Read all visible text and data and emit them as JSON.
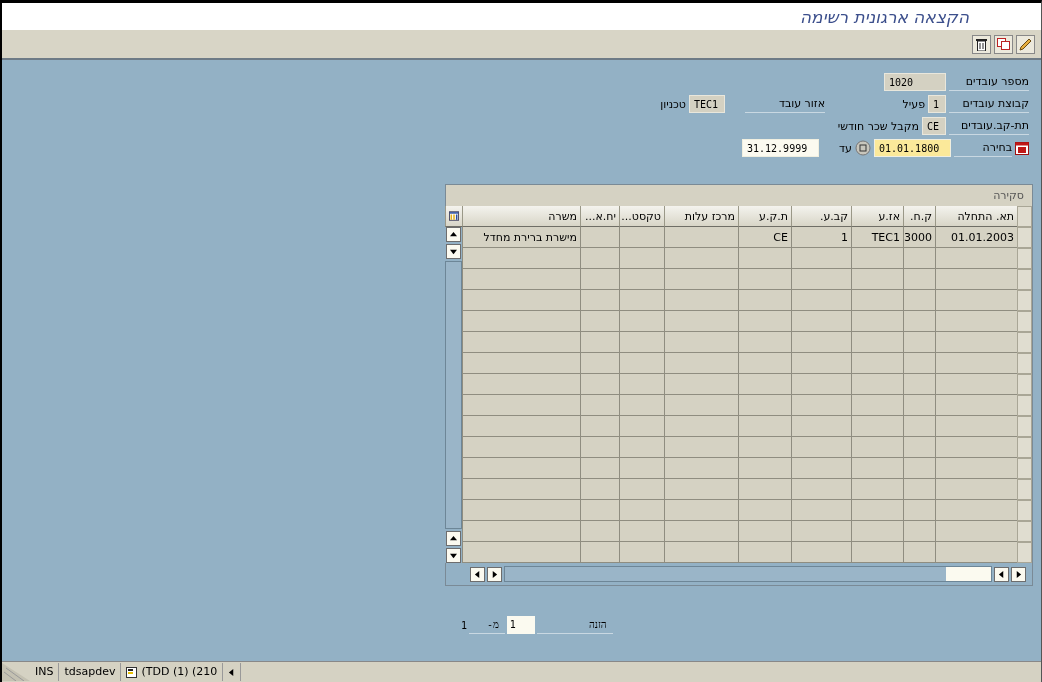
{
  "window": {
    "title": "הקצאה ארגונית רשימה"
  },
  "form": {
    "personnel_number": {
      "label": "מספר עובדים",
      "value": "1020"
    },
    "employee_group": {
      "label": "קבוצת עובדים",
      "value": "1",
      "text": "פעיל"
    },
    "personnel_area": {
      "label": "אזור עובד",
      "value": "TEC1",
      "text": "טכניון"
    },
    "employee_subgroup": {
      "label": "תת-קב.עובדים",
      "value": "CE",
      "text": "מקבל שכר חודשי"
    },
    "selection": {
      "label": "בחירה",
      "from": "01.01.1800",
      "to_label": "עד",
      "to": "31.12.9999"
    }
  },
  "table": {
    "title": "סקירה",
    "columns": [
      "תא. התחלה",
      "ק.ח.",
      "אז.ע",
      "קב.ע.",
      "ת.ק.ע",
      "מרכז עלות",
      "טקסט...",
      "יח.א...",
      "משרה"
    ],
    "rows": [
      {
        "cells": [
          "01.01.2003",
          "3000",
          "TEC1",
          "1",
          "CE",
          null,
          null,
          null,
          "מישרת ברירת מחדל"
        ]
      }
    ]
  },
  "entry": {
    "label": "הזנה",
    "value": "1",
    "of_label": "מ-",
    "total": "1"
  },
  "status_bar": {
    "mode": "INS",
    "server": "tdsapdev",
    "session": "(TDD (1) (210"
  }
}
